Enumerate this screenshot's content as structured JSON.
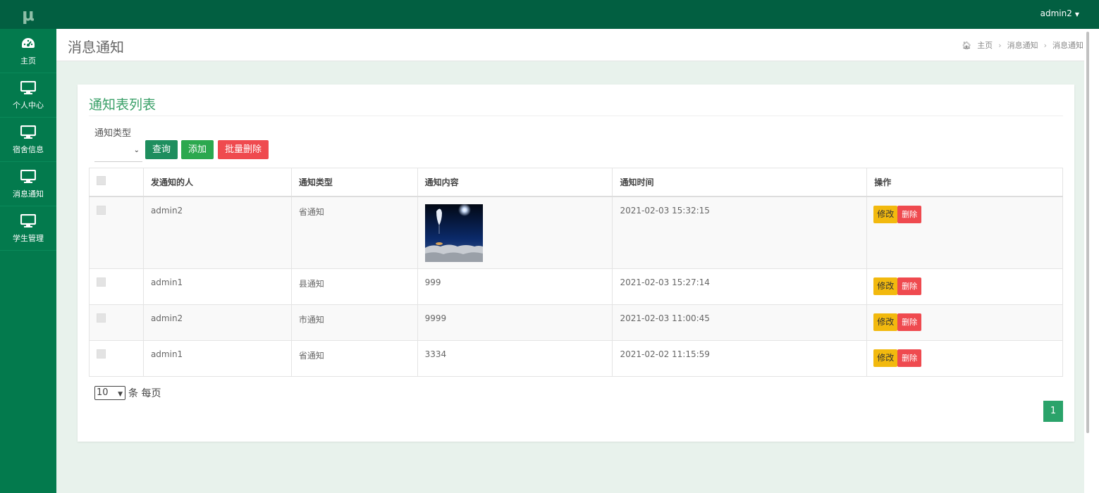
{
  "app": {
    "logo": "μ"
  },
  "topbar": {
    "user": "admin2"
  },
  "sidebar": {
    "items": [
      {
        "label": "主页",
        "icon": "dashboard-icon"
      },
      {
        "label": "个人中心",
        "icon": "monitor-icon"
      },
      {
        "label": "宿舍信息",
        "icon": "monitor-icon"
      },
      {
        "label": "消息通知",
        "icon": "monitor-icon"
      },
      {
        "label": "学生管理",
        "icon": "monitor-icon"
      }
    ]
  },
  "header": {
    "title": "消息通知",
    "breadcrumb": [
      "主页",
      "消息通知",
      "消息通知"
    ]
  },
  "card": {
    "title": "通知表列表",
    "filter_label": "通知类型",
    "filter_value": "",
    "buttons": {
      "query": "查询",
      "add": "添加",
      "batch_delete": "批量删除"
    }
  },
  "table": {
    "headers": [
      "发通知的人",
      "通知类型",
      "通知内容",
      "通知时间",
      "操作"
    ],
    "rows": [
      {
        "sender": "admin2",
        "type": "省通知",
        "content": "",
        "content_is_image": true,
        "time": "2021-02-03 15:32:15"
      },
      {
        "sender": "admin1",
        "type": "县通知",
        "content": "999",
        "content_is_image": false,
        "time": "2021-02-03 15:27:14"
      },
      {
        "sender": "admin2",
        "type": "市通知",
        "content": "9999",
        "content_is_image": false,
        "time": "2021-02-03 11:00:45"
      },
      {
        "sender": "admin1",
        "type": "省通知",
        "content": "3334",
        "content_is_image": false,
        "time": "2021-02-02 11:15:59"
      }
    ],
    "actions": {
      "edit": "修改",
      "delete": "删除"
    }
  },
  "pagination": {
    "page_size": "10",
    "page_size_suffix": "条 每页",
    "current_page": "1"
  },
  "colors": {
    "sidebar": "#037a4d",
    "topbar": "#025f41",
    "accent": "#2aa36a",
    "danger": "#ef4a4f",
    "warning": "#f2b90e"
  }
}
